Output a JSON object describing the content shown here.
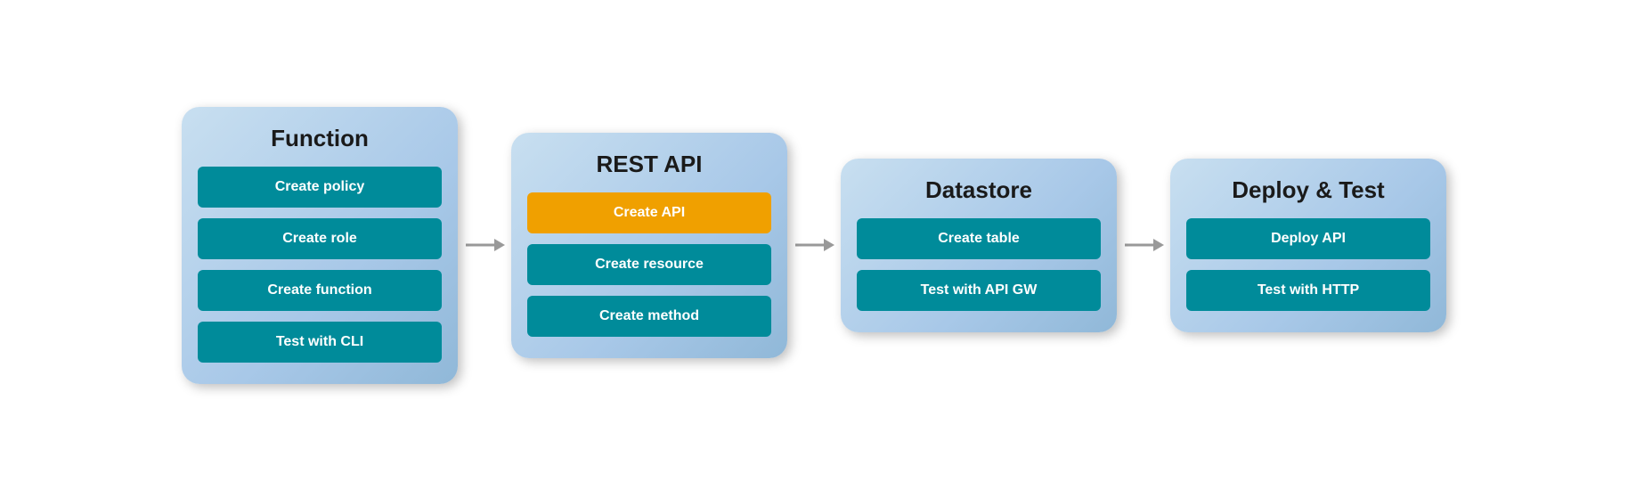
{
  "panels": [
    {
      "id": "function",
      "title": "Function",
      "buttons": [
        {
          "id": "create-policy",
          "label": "Create policy",
          "style": "teal"
        },
        {
          "id": "create-role",
          "label": "Create role",
          "style": "teal"
        },
        {
          "id": "create-function",
          "label": "Create function",
          "style": "teal"
        },
        {
          "id": "test-cli",
          "label": "Test with CLI",
          "style": "teal"
        }
      ]
    },
    {
      "id": "rest-api",
      "title": "REST API",
      "buttons": [
        {
          "id": "create-api",
          "label": "Create API",
          "style": "orange"
        },
        {
          "id": "create-resource",
          "label": "Create resource",
          "style": "teal"
        },
        {
          "id": "create-method",
          "label": "Create method",
          "style": "teal"
        }
      ]
    },
    {
      "id": "datastore",
      "title": "Datastore",
      "buttons": [
        {
          "id": "create-table",
          "label": "Create table",
          "style": "teal"
        },
        {
          "id": "test-api-gw",
          "label": "Test with API GW",
          "style": "teal"
        }
      ]
    },
    {
      "id": "deploy-test",
      "title": "Deploy & Test",
      "buttons": [
        {
          "id": "deploy-api",
          "label": "Deploy API",
          "style": "teal"
        },
        {
          "id": "test-http",
          "label": "Test with HTTP",
          "style": "teal"
        }
      ]
    }
  ],
  "arrows": [
    {
      "id": "arrow-1"
    },
    {
      "id": "arrow-2"
    },
    {
      "id": "arrow-3"
    }
  ]
}
